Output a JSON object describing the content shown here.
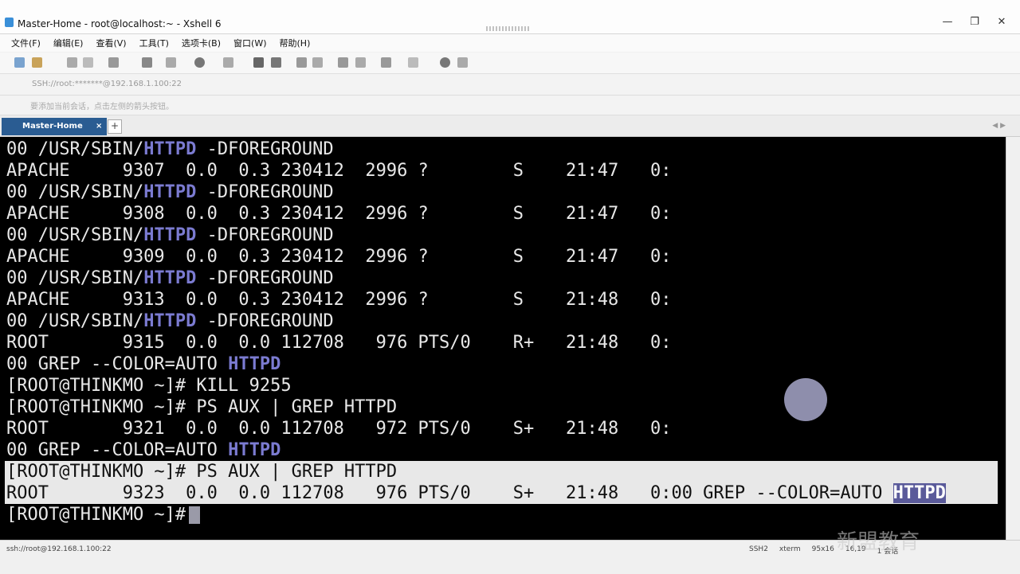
{
  "window": {
    "title": "Master-Home - root@localhost:~ - Xshell 6",
    "controls": [
      "—",
      "❐",
      "✕"
    ]
  },
  "menu": [
    "文件(F)",
    "编辑(E)",
    "查看(V)",
    "工具(T)",
    "选项卡(B)",
    "窗口(W)",
    "帮助(H)"
  ],
  "address": "SSH://root:*******@192.168.1.100:22",
  "tip": "要添加当前会话，点击左侧的箭头按钮。",
  "tab": {
    "label": "Master-Home",
    "index": "1",
    "close": "×",
    "add": "+"
  },
  "terminal": {
    "lines": [
      {
        "pre": "00 /USR/SBIN/",
        "match": "HTTPD",
        "post": " -DFOREGROUND"
      },
      {
        "pre": "APACHE     9307  0.0  0.3 230412  2996 ?        S    21:47   0:",
        "match": "",
        "post": ""
      },
      {
        "pre": "00 /USR/SBIN/",
        "match": "HTTPD",
        "post": " -DFOREGROUND"
      },
      {
        "pre": "APACHE     9308  0.0  0.3 230412  2996 ?        S    21:47   0:",
        "match": "",
        "post": ""
      },
      {
        "pre": "00 /USR/SBIN/",
        "match": "HTTPD",
        "post": " -DFOREGROUND"
      },
      {
        "pre": "APACHE     9309  0.0  0.3 230412  2996 ?        S    21:47   0:",
        "match": "",
        "post": ""
      },
      {
        "pre": "00 /USR/SBIN/",
        "match": "HTTPD",
        "post": " -DFOREGROUND"
      },
      {
        "pre": "APACHE     9313  0.0  0.3 230412  2996 ?        S    21:48   0:",
        "match": "",
        "post": ""
      },
      {
        "pre": "00 /USR/SBIN/",
        "match": "HTTPD",
        "post": " -DFOREGROUND"
      },
      {
        "pre": "ROOT       9315  0.0  0.0 112708   976 PTS/0    R+   21:48   0:",
        "match": "",
        "post": ""
      },
      {
        "pre": "00 GREP --COLOR=AUTO ",
        "match": "HTTPD",
        "post": ""
      },
      {
        "pre": "[ROOT@THINKMO ~]# KILL 9255",
        "match": "",
        "post": ""
      },
      {
        "pre": "[ROOT@THINKMO ~]# PS AUX | GREP HTTPD",
        "match": "",
        "post": ""
      },
      {
        "pre": "ROOT       9321  0.0  0.0 112708   972 PTS/0    S+   21:48   0:",
        "match": "",
        "post": ""
      },
      {
        "pre": "00 GREP --COLOR=AUTO ",
        "match": "HTTPD",
        "post": ""
      }
    ],
    "highlighted_lines": [
      {
        "pre": "[ROOT@THINKMO ~]# PS AUX | GREP HTTPD",
        "match": "",
        "post": ""
      },
      {
        "pre": "ROOT       9323  0.0  0.0 112708   976 PTS/0    S+   21:48   0:00 GREP --COLOR=AUTO ",
        "match": "HTTPD",
        "post": ""
      }
    ],
    "prompt": "[ROOT@THINKMO ~]#",
    "colors": {
      "background": "#000000",
      "text": "#e8e8e8",
      "match": "#7b7bd1"
    }
  },
  "status": {
    "connection": "ssh://root@192.168.1.100:22",
    "items": [
      "SSH2",
      "xterm",
      "95x16",
      "16,19",
      "1 会话"
    ]
  },
  "watermark": "新盟教育"
}
